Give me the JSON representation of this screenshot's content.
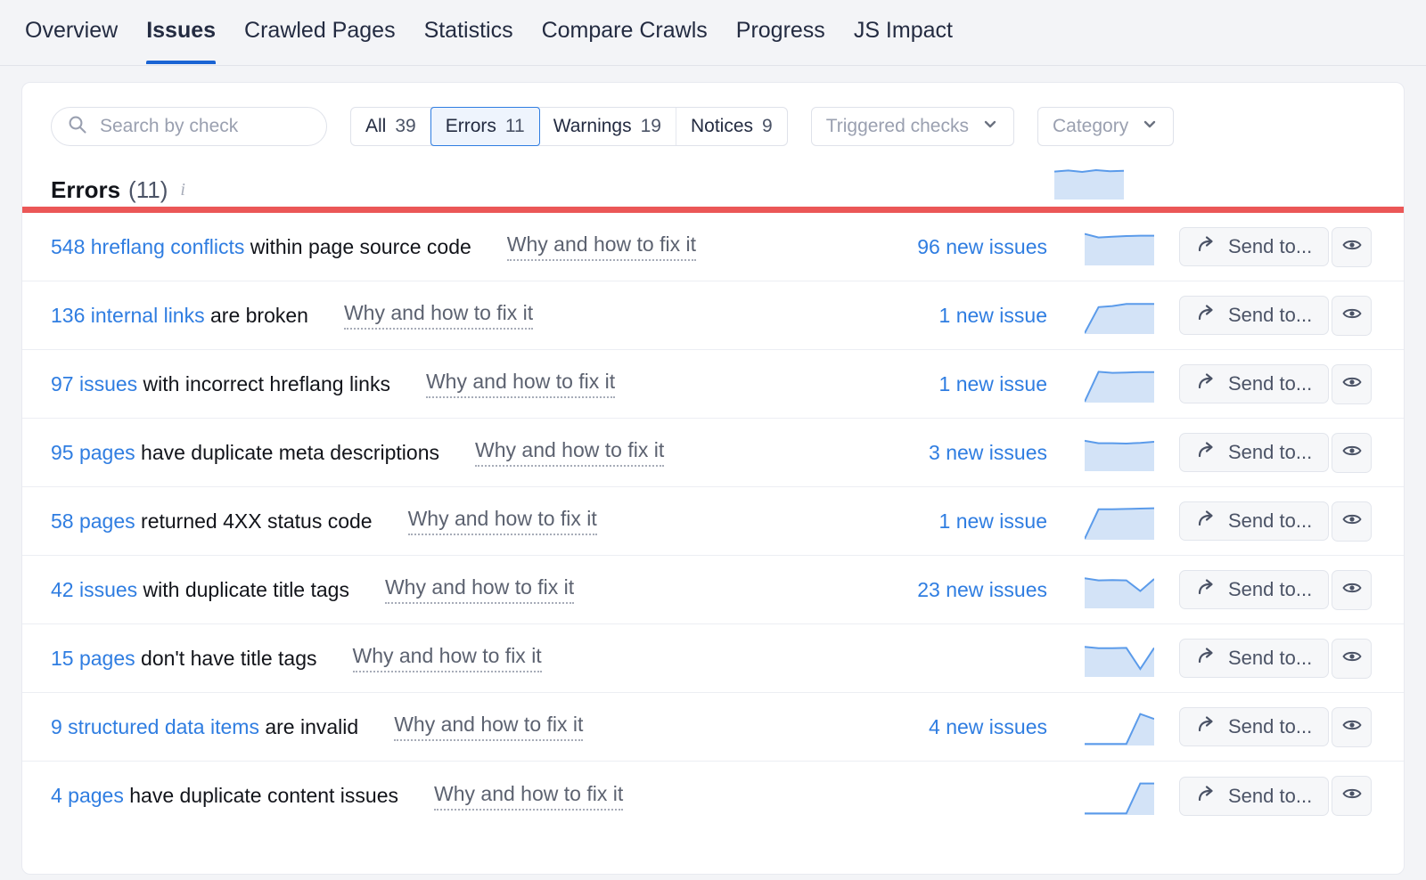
{
  "tabs": [
    {
      "label": "Overview",
      "active": false
    },
    {
      "label": "Issues",
      "active": true
    },
    {
      "label": "Crawled Pages",
      "active": false
    },
    {
      "label": "Statistics",
      "active": false
    },
    {
      "label": "Compare Crawls",
      "active": false
    },
    {
      "label": "Progress",
      "active": false
    },
    {
      "label": "JS Impact",
      "active": false
    }
  ],
  "search": {
    "placeholder": "Search by check",
    "value": "",
    "icon": "search-icon"
  },
  "segments": [
    {
      "label": "All",
      "count": "39",
      "selected": false
    },
    {
      "label": "Errors",
      "count": "11",
      "selected": true
    },
    {
      "label": "Warnings",
      "count": "19",
      "selected": false
    },
    {
      "label": "Notices",
      "count": "9",
      "selected": false
    }
  ],
  "dropdowns": [
    {
      "label": "Triggered checks",
      "icon": "chevron-down-icon"
    },
    {
      "label": "Category",
      "icon": "chevron-down-icon"
    }
  ],
  "section": {
    "title": "Errors",
    "count": "(11)",
    "info_icon": "info-icon",
    "severity_color": "#eb5757"
  },
  "colors": {
    "link": "#2f7de1",
    "tab_active_underline": "#1a64d4",
    "error_bar": "#eb5757",
    "spark_line": "#5b9bea",
    "spark_fill": "#d3e3f7"
  },
  "buttons": {
    "send_to_label": "Send to...",
    "send_to_icon": "share-arrow-icon",
    "eye_icon": "eye-icon"
  },
  "chart_data": {
    "type": "line",
    "title": "Issue trend sparklines",
    "note": "Small area sparklines, one per issue row plus one in the section header. y values are relative trend magnitudes (0-10) across equal time steps.",
    "series": [
      {
        "name": "header",
        "values": [
          7.6,
          7.9,
          7.5,
          8.0,
          7.7,
          7.8
        ]
      },
      {
        "name": "548 hreflang conflicts within page source code",
        "values": [
          8.6,
          7.6,
          7.8,
          8.0,
          8.1,
          8.1
        ]
      },
      {
        "name": "136 internal links are broken",
        "values": [
          0.0,
          7.3,
          7.6,
          8.2,
          8.2,
          8.2
        ]
      },
      {
        "name": "97 issues with incorrect hreflang links",
        "values": [
          0.0,
          8.4,
          8.1,
          8.2,
          8.3,
          8.3
        ]
      },
      {
        "name": "95 pages have duplicate meta descriptions",
        "values": [
          8.3,
          7.6,
          7.6,
          7.5,
          7.7,
          8.0
        ]
      },
      {
        "name": "58 pages returned 4XX status code",
        "values": [
          0.0,
          8.3,
          8.3,
          8.4,
          8.5,
          8.6
        ]
      },
      {
        "name": "42 issues with duplicate title tags",
        "values": [
          8.2,
          7.6,
          7.7,
          7.6,
          4.6,
          8.0
        ]
      },
      {
        "name": "15 pages don't have title tags",
        "values": [
          8.2,
          7.8,
          7.8,
          7.9,
          2.0,
          7.9
        ]
      },
      {
        "name": "9 structured data items are invalid",
        "values": [
          0.2,
          0.2,
          0.2,
          0.2,
          8.6,
          7.2
        ]
      },
      {
        "name": "4 pages have duplicate content issues",
        "values": [
          0.2,
          0.2,
          0.2,
          0.2,
          8.6,
          8.6
        ]
      }
    ]
  },
  "rows": [
    {
      "link_text": "548 hreflang conflicts",
      "rest_text": " within page source code",
      "fix_link": "Why and how to fix it",
      "new_issues": "96 new issues",
      "spark": "0",
      "send_to": "Send to...",
      "eye": "eye-icon"
    },
    {
      "link_text": "136 internal links",
      "rest_text": " are broken",
      "fix_link": "Why and how to fix it",
      "new_issues": "1 new issue",
      "spark": "1",
      "send_to": "Send to...",
      "eye": "eye-icon"
    },
    {
      "link_text": "97 issues",
      "rest_text": " with incorrect hreflang links",
      "fix_link": "Why and how to fix it",
      "new_issues": "1 new issue",
      "spark": "2",
      "send_to": "Send to...",
      "eye": "eye-icon"
    },
    {
      "link_text": "95 pages",
      "rest_text": " have duplicate meta descriptions",
      "fix_link": "Why and how to fix it",
      "new_issues": "3 new issues",
      "spark": "3",
      "send_to": "Send to...",
      "eye": "eye-icon"
    },
    {
      "link_text": "58 pages",
      "rest_text": " returned 4XX status code",
      "fix_link": "Why and how to fix it",
      "new_issues": "1 new issue",
      "spark": "4",
      "send_to": "Send to...",
      "eye": "eye-icon"
    },
    {
      "link_text": "42 issues",
      "rest_text": " with duplicate title tags",
      "fix_link": "Why and how to fix it",
      "new_issues": "23 new issues",
      "spark": "5",
      "send_to": "Send to...",
      "eye": "eye-icon"
    },
    {
      "link_text": "15 pages",
      "rest_text": " don't have title tags",
      "fix_link": "Why and how to fix it",
      "new_issues": "",
      "spark": "6",
      "send_to": "Send to...",
      "eye": "eye-icon"
    },
    {
      "link_text": "9 structured data items",
      "rest_text": " are invalid",
      "fix_link": "Why and how to fix it",
      "new_issues": "4 new issues",
      "spark": "7",
      "send_to": "Send to...",
      "eye": "eye-icon"
    },
    {
      "link_text": "4 pages",
      "rest_text": " have duplicate content issues",
      "fix_link": "Why and how to fix it",
      "new_issues": "",
      "spark": "8",
      "send_to": "Send to...",
      "eye": "eye-icon"
    }
  ]
}
